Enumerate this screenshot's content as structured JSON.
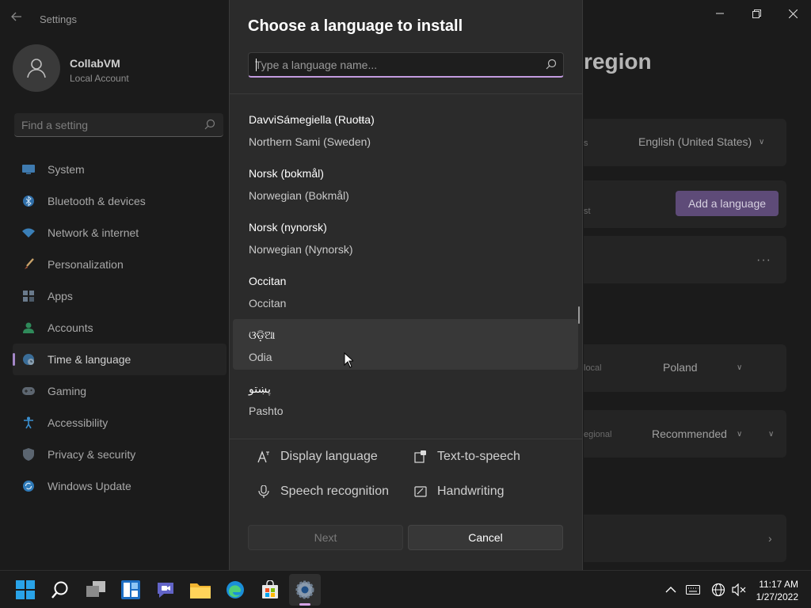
{
  "settings": {
    "app_title": "Settings",
    "profile": {
      "name": "CollabVM",
      "account_type": "Local Account"
    },
    "search_placeholder": "Find a setting",
    "nav": [
      {
        "label": "System",
        "icon": "monitor-icon"
      },
      {
        "label": "Bluetooth & devices",
        "icon": "bluetooth-icon"
      },
      {
        "label": "Network & internet",
        "icon": "wifi-icon"
      },
      {
        "label": "Personalization",
        "icon": "brush-icon"
      },
      {
        "label": "Apps",
        "icon": "apps-icon"
      },
      {
        "label": "Accounts",
        "icon": "person-icon"
      },
      {
        "label": "Time & language",
        "icon": "globe-clock-icon",
        "active": true
      },
      {
        "label": "Gaming",
        "icon": "gamepad-icon"
      },
      {
        "label": "Accessibility",
        "icon": "accessibility-icon"
      },
      {
        "label": "Privacy & security",
        "icon": "shield-icon"
      },
      {
        "label": "Windows Update",
        "icon": "update-icon"
      }
    ],
    "page_title_fragment": "region",
    "windows_display_language_value": "English (United States)",
    "windows_display_language_fragment": "s",
    "preferred_languages_fragment": "st",
    "add_language_button": "Add a language",
    "country_label_fragment": "local",
    "country_value": "Poland",
    "regional_format_label_fragment": "egional",
    "regional_format_value": "Recommended"
  },
  "dialog": {
    "title": "Choose a language to install",
    "search_placeholder": "Type a language name...",
    "languages": [
      {
        "native": "DavviSámegiella (Ruoŧŧa)",
        "english": "Northern Sami (Sweden)"
      },
      {
        "native": "Norsk (bokmål)",
        "english": "Norwegian (Bokmål)"
      },
      {
        "native": "Norsk (nynorsk)",
        "english": "Norwegian (Nynorsk)"
      },
      {
        "native": "Occitan",
        "english": "Occitan"
      },
      {
        "native": "ଓଡ଼ିଆ",
        "english": "Odia",
        "hovered": true
      },
      {
        "native": "پښتو",
        "english": "Pashto"
      }
    ],
    "features": [
      {
        "label": "Display language",
        "icon": "display-language-icon"
      },
      {
        "label": "Text-to-speech",
        "icon": "text-to-speech-icon"
      },
      {
        "label": "Speech recognition",
        "icon": "microphone-icon"
      },
      {
        "label": "Handwriting",
        "icon": "handwriting-icon"
      }
    ],
    "next_button": "Next",
    "cancel_button": "Cancel"
  },
  "taskbar": {
    "apps": [
      "start-icon",
      "search-icon",
      "task-view-icon",
      "widgets-icon",
      "teams-chat-icon",
      "file-explorer-icon",
      "edge-icon",
      "store-icon",
      "settings-gear-icon"
    ],
    "active_app": "settings-gear-icon",
    "time": "11:17 AM",
    "date": "1/27/2022"
  },
  "colors": {
    "accent": "#c39be0",
    "add_language_bg": "#5e4b78",
    "dialog_bg": "#2b2b2b",
    "window_bg": "#1b1b1b"
  }
}
